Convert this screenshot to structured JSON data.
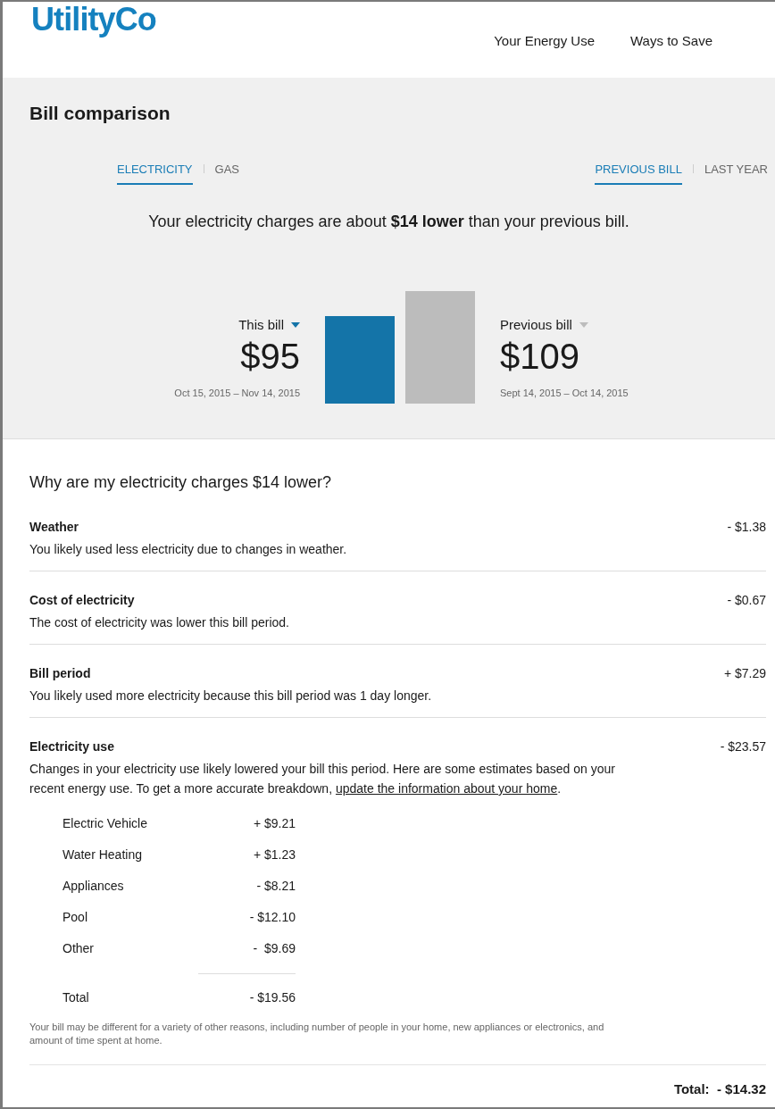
{
  "header": {
    "logo": "UtilityCo",
    "nav": [
      "Your Energy Use",
      "Ways to Save"
    ]
  },
  "comparison": {
    "title": "Bill comparison",
    "fuel_tabs": [
      {
        "label": "ELECTRICITY",
        "selected": true
      },
      {
        "label": "GAS",
        "selected": false
      }
    ],
    "period_tabs": [
      {
        "label": "PREVIOUS BILL",
        "selected": true
      },
      {
        "label": "LAST YEAR",
        "selected": false
      }
    ],
    "summary": "Your electricity charges are about **$14 lower** than your previous bill.",
    "bills": [
      {
        "label": "This bill",
        "amount": "$95",
        "dates": "Oct 15, 2015 – Nov 14, 2015",
        "color": "#1474a8"
      },
      {
        "label": "Previous bill",
        "amount": "$109",
        "dates": "Sept 14, 2015 – Oct 14, 2015",
        "color": "#bcbcbc"
      }
    ]
  },
  "details": {
    "question": "Why are my electricity charges $14 lower?",
    "reasons": [
      {
        "title": "Weather",
        "description": "You likely used less electricity due to changes in weather.",
        "amount": "- $1.38"
      },
      {
        "title": "Cost of electricity",
        "description": "The cost of electricity was lower this bill period.",
        "amount": "- $0.67"
      },
      {
        "title": "Bill period",
        "description": "You likely used more electricity because this bill period was 1 day longer.",
        "amount": "+ $7.29"
      },
      {
        "title": "Electricity use",
        "description": "Changes in your electricity use likely lowered your bill this period. Here are some estimates based on your recent energy use. To get a more accurate breakdown,",
        "link": "update the information about your home",
        "description_end": ".",
        "amount": "- $23.57"
      }
    ],
    "breakdown": [
      {
        "label": "Electric Vehicle",
        "amount": "+ $9.21"
      },
      {
        "label": "Water Heating",
        "amount": "+ $1.23"
      },
      {
        "label": "Appliances",
        "amount": "- $8.21"
      },
      {
        "label": "Pool",
        "amount": "- $12.10"
      },
      {
        "label": "Other",
        "amount": "-  $9.69"
      }
    ],
    "breakdown_total": {
      "label": "Total",
      "amount": "- $19.56"
    },
    "footnote": "Your bill may be different for a variety of other reasons, including number of people in your home, new appliances or electronics, and amount of time spent at home.",
    "grand_total": "Total:  - $14.32"
  }
}
